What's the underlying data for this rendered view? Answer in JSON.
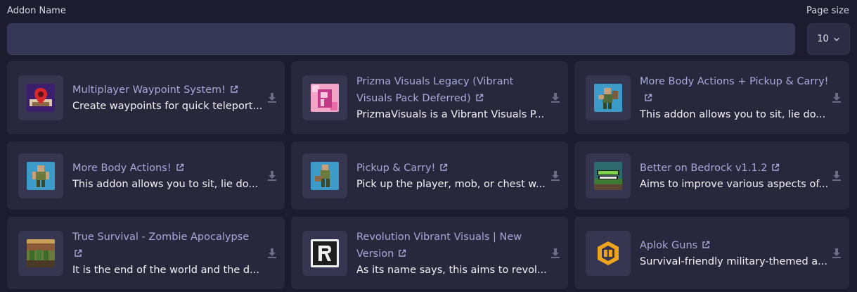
{
  "header": {
    "addon_name_label": "Addon Name",
    "page_size_label": "Page size",
    "search": {
      "value": "",
      "placeholder": ""
    },
    "page_size_value": "10"
  },
  "addons": [
    {
      "title": "Multiplayer Waypoint System!",
      "description": "Create waypoints for quick teleport...",
      "thumb": "waypoint-pin-icon"
    },
    {
      "title": "Prizma Visuals Legacy (Vibrant Visuals Pack Deferred)",
      "description": "PrizmaVisuals is a Vibrant Visuals P...",
      "thumb": "prizma-logo"
    },
    {
      "title": "More Body Actions + Pickup & Carry!",
      "description": "This addon allows you to sit, lie do...",
      "thumb": "body-actions-carry-art"
    },
    {
      "title": "More Body Actions!",
      "description": "This addon allows you to sit, lie do...",
      "thumb": "body-actions-art"
    },
    {
      "title": "Pickup & Carry!",
      "description": "Pick up the player, mob, or chest w...",
      "thumb": "pickup-carry-art"
    },
    {
      "title": "Better on Bedrock v1.1.2",
      "description": "Aims to improve various aspects of...",
      "thumb": "better-on-bedrock-logo"
    },
    {
      "title": "True Survival - Zombie Apocalypse",
      "description": "It is the end of the world and the d...",
      "thumb": "true-survival-art"
    },
    {
      "title": "Revolution Vibrant Visuals | New Version",
      "description": "As its name says, this aims to revol...",
      "thumb": "revolution-logo"
    },
    {
      "title": "Aplok Guns",
      "description": "Survival-friendly military-themed a...",
      "thumb": "aplok-logo"
    }
  ],
  "colors": {
    "background": "#1c1c2e",
    "card": "#28283d",
    "title": "#a9a8d8",
    "description": "#f4f4fa",
    "input": "#363656"
  }
}
